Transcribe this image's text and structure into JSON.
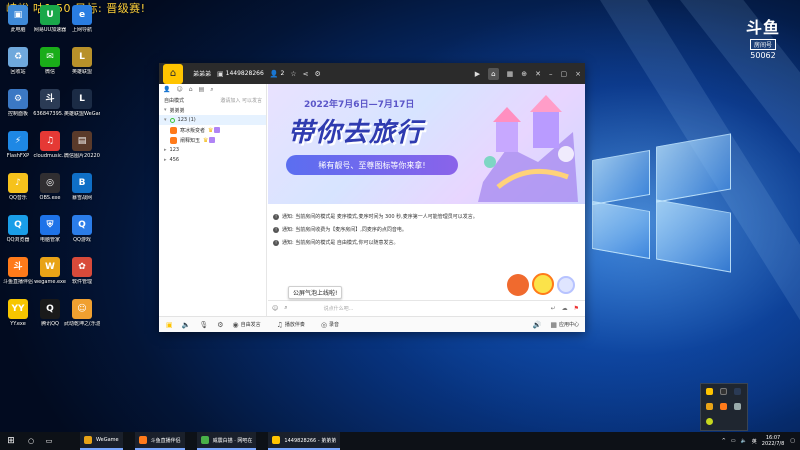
{
  "overlay_text": "峡峪 咕1 50 目标: 晋级赛!",
  "douyu_logo": {
    "brand": "斗鱼",
    "room_label": "房间号",
    "room_number": "50062"
  },
  "desktop_icons": [
    {
      "label": "此电脑",
      "color": "#3f8ad8",
      "glyph": "▣",
      "icon": "computer-icon"
    },
    {
      "label": "网易UU加速器",
      "color": "#1aa84a",
      "glyph": "U",
      "icon": "uu-icon"
    },
    {
      "label": "上网导航",
      "color": "#2a7de1",
      "glyph": "e",
      "icon": "browser-icon"
    },
    {
      "label": "回收站",
      "color": "#6fa8dc",
      "glyph": "♻",
      "icon": "recycle-bin-icon"
    },
    {
      "label": "微信",
      "color": "#1aad19",
      "glyph": "✉",
      "icon": "wechat-icon"
    },
    {
      "label": "英雄联盟",
      "color": "#b8912a",
      "glyph": "L",
      "icon": "lol-icon"
    },
    {
      "label": "控制面板",
      "color": "#3b78c4",
      "glyph": "⚙",
      "icon": "control-panel-icon"
    },
    {
      "label": "636847395...",
      "color": "#2b3b55",
      "glyph": "斗",
      "icon": "douyu-icon"
    },
    {
      "label": "英雄联盟WeGame版",
      "color": "#1b2b45",
      "glyph": "L",
      "icon": "lol-wegame-icon"
    },
    {
      "label": "FlashFXP",
      "color": "#1e88e5",
      "glyph": "⚡",
      "icon": "flashfxp-icon"
    },
    {
      "label": "cloudmusic...",
      "color": "#e53935",
      "glyph": "♫",
      "icon": "cloudmusic-icon"
    },
    {
      "label": "微信图片20220607...",
      "color": "#5a3a2a",
      "glyph": "▤",
      "icon": "image-icon"
    },
    {
      "label": "QQ音乐",
      "color": "#f6c21c",
      "glyph": "♪",
      "icon": "qqmusic-icon"
    },
    {
      "label": "OBS.exe",
      "color": "#302e31",
      "glyph": "◎",
      "icon": "obs-icon"
    },
    {
      "label": "暴雪战网",
      "color": "#0f6fc6",
      "glyph": "B",
      "icon": "battlenet-icon"
    },
    {
      "label": "QQ浏览器",
      "color": "#1a9ee8",
      "glyph": "Q",
      "icon": "qqbrowser-icon"
    },
    {
      "label": "电脑管家",
      "color": "#1e73e8",
      "glyph": "⛨",
      "icon": "pc-manager-icon"
    },
    {
      "label": "QQ游戏",
      "color": "#2b7de9",
      "glyph": "Q",
      "icon": "qqgame-icon"
    },
    {
      "label": "斗鱼直播伴侣",
      "color": "#ff7a1a",
      "glyph": "斗",
      "icon": "douyu-companion-icon"
    },
    {
      "label": "wegame.exe",
      "color": "#e8a317",
      "glyph": "W",
      "icon": "wegame-icon"
    },
    {
      "label": "软件管理",
      "color": "#d84a3a",
      "glyph": "✿",
      "icon": "software-manager-icon"
    },
    {
      "label": "YY.exe",
      "color": "#f7c600",
      "glyph": "YY",
      "icon": "yy-icon"
    },
    {
      "label": "腾讯QQ",
      "color": "#1a1a1a",
      "glyph": "Q",
      "icon": "qq-icon"
    },
    {
      "label": "武动乾坤之(乐游电脑版)",
      "color": "#f0a030",
      "glyph": "☺",
      "icon": "game-icon"
    }
  ],
  "app": {
    "title_name": "弟弟弟",
    "user_id": "1449828266",
    "count": "2",
    "sidebar_tabs": [
      "👤",
      "☺",
      "⌂",
      "▤",
      "⌕"
    ],
    "sidebar_rows": [
      {
        "text": "自由模式",
        "hint": "邀请加入 可以发言"
      },
      {
        "text": "弟弟弟",
        "arrow": "▾"
      },
      {
        "text": "123 (1)",
        "arrow": "▾",
        "selected": true
      },
      {
        "text": "寒冰叛变者"
      },
      {
        "text": "阐释知玉"
      },
      {
        "text": "123",
        "arrow": "▸"
      },
      {
        "text": "456",
        "arrow": "▸"
      }
    ],
    "banner": {
      "date": "2022年7月6日—7月17日",
      "headline": "带你去旅行",
      "subline": "稀有靓号、至尊图标等你来拿!"
    },
    "notices": [
      "通知: 当前房间的模式是 麦序模式,麦序时间为 300 秒,麦序第一人可能管理员可以发言。",
      "通知: 当前房间收费为【麦序房间】,同麦序的点同音电。",
      "通知: 当前房间的模式是 自由模式,你可以随意发言。"
    ],
    "tooltip": "公屏气泡上线啦!",
    "input_placeholder": "说点什么吧...",
    "bottom_items": [
      "自由发言",
      "播放伴奏",
      "录音"
    ],
    "bottom_right": "应用中心"
  },
  "taskbar": {
    "tasks": [
      {
        "label": "WeGame",
        "color": "#e8a317"
      },
      {
        "label": "斗鱼直播伴侣",
        "color": "#ff7a1a"
      },
      {
        "label": "威震白描 · 网吧在",
        "color": "#49b048"
      },
      {
        "label": "1449828266 - 弟弟弟",
        "color": "#ffc400"
      }
    ],
    "ime": "英",
    "time": "16:07",
    "date": "2022/7/8"
  }
}
